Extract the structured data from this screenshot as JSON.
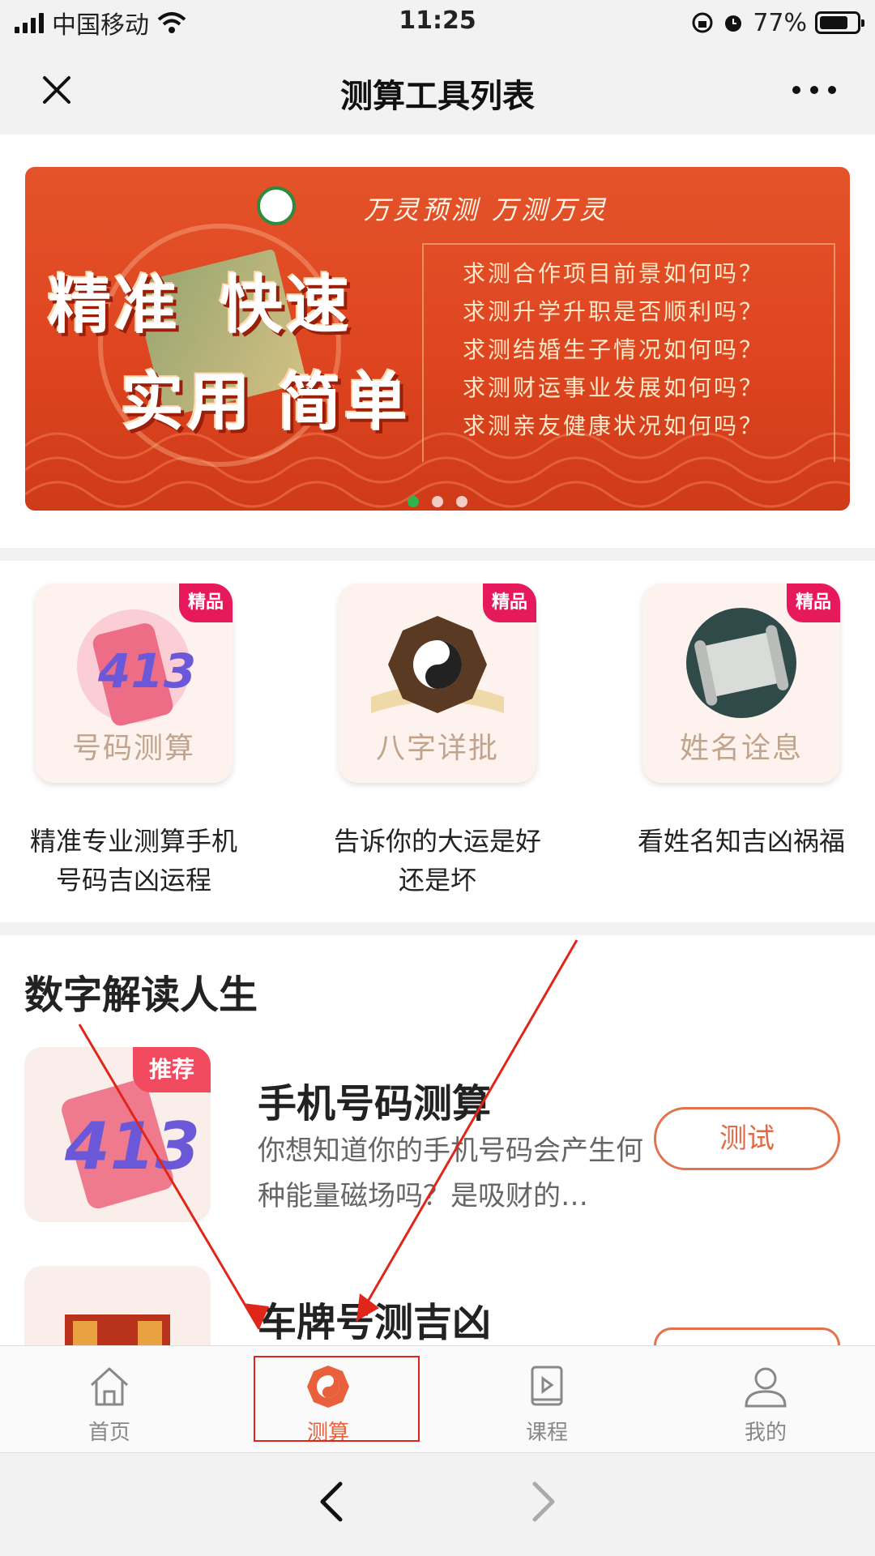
{
  "status_bar": {
    "carrier": "中国移动",
    "time": "11:25",
    "battery": "77%",
    "battery_level": 0.77
  },
  "nav": {
    "title": "测算工具列表"
  },
  "banner": {
    "slogan": "万灵预测 万测万灵",
    "headline_1": "精准",
    "headline_2": "快速",
    "headline_3": "实用",
    "headline_4": "简单",
    "questions": [
      "求测合作项目前景如何吗？",
      "求测升学升职是否顺利吗？",
      "求测结婚生子情况如何吗？",
      "求测财运事业发展如何吗？",
      "求测亲友健康状况如何吗？"
    ],
    "slide_count": 3,
    "active_slide": 1
  },
  "featured": [
    {
      "badge": "精品",
      "label": "号码测算",
      "desc": "精准专业测算手机号码吉凶运程"
    },
    {
      "badge": "精品",
      "label": "八字详批",
      "desc": "告诉你的大运是好还是坏"
    },
    {
      "badge": "精品",
      "label": "姓名诠息",
      "desc": "看姓名知吉凶祸福"
    }
  ],
  "section": {
    "title": "数字解读人生",
    "items": [
      {
        "badge": "推荐",
        "art_text": "413",
        "title": "手机号码测算",
        "desc": "你想知道你的手机号码会产生何种能量磁场吗？是吸财的…",
        "button": "测试"
      },
      {
        "title": "车牌号测吉凶"
      }
    ]
  },
  "tab_bar": {
    "items": [
      {
        "label": "首页",
        "icon": "home-icon"
      },
      {
        "label": "测算",
        "icon": "bagua-icon",
        "active": true
      },
      {
        "label": "课程",
        "icon": "course-icon"
      },
      {
        "label": "我的",
        "icon": "user-icon"
      }
    ]
  },
  "colors": {
    "accent": "#e8613c",
    "badge": "#e5195c",
    "banner": "#de4520",
    "annotation": "#e0261a"
  }
}
